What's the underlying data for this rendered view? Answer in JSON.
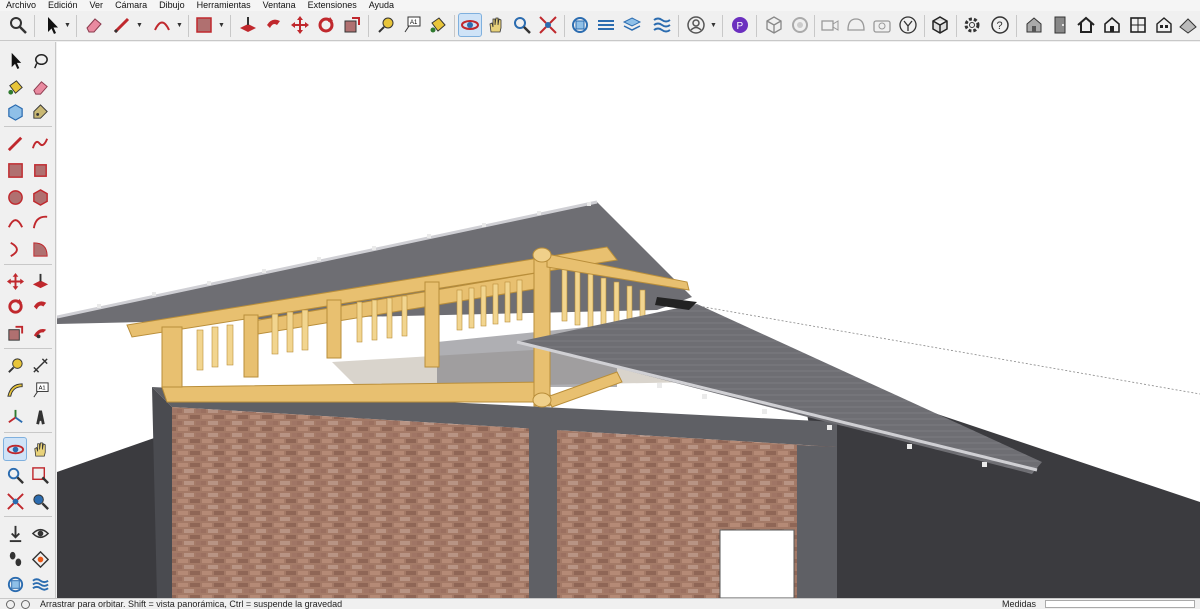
{
  "menu": {
    "items": [
      "Archivo",
      "Edición",
      "Ver",
      "Cámara",
      "Dibujo",
      "Herramientas",
      "Ventana",
      "Extensiones",
      "Ayuda"
    ]
  },
  "top_toolbar": {
    "tools": [
      "zoom-extents-icon",
      "select-icon",
      "eraser-icon",
      "pencil-icon",
      "arc-icon",
      "rectangle-icon",
      "push-pull-icon",
      "follow-me-icon",
      "move-icon",
      "rotate-icon",
      "scale-icon",
      "tape-measure-icon",
      "text-icon",
      "paint-bucket-icon",
      "orbit-icon",
      "pan-icon",
      "zoom-icon",
      "zoom-window-icon",
      "components-icon",
      "styles-icon",
      "layers-icon",
      "sandbox-icon",
      "account-icon",
      "profile-icon",
      "warehouse-icon",
      "extension-icon",
      "video-icon",
      "dome-icon",
      "camera-icon",
      "trimble-icon",
      "box-icon",
      "settings-icon",
      "help-icon",
      "house-icon",
      "door-icon",
      "home-icon",
      "window-icon",
      "scene-icon"
    ],
    "active_tool": "orbit-icon"
  },
  "left_toolbar": {
    "active_tool": "orbit-icon"
  },
  "statusbar": {
    "hint": "Arrastrar para orbitar. Shift = vista panorámica, Ctrl = suspende la gravedad",
    "measure_label": "Medidas",
    "measure_value": ""
  },
  "colors": {
    "accent": "#2b6cb0",
    "red_tools": "#c0282d",
    "timber": "#e8c070",
    "roof": "#6e6e73",
    "brick": "#a47a67",
    "concrete": "#5f6065"
  }
}
